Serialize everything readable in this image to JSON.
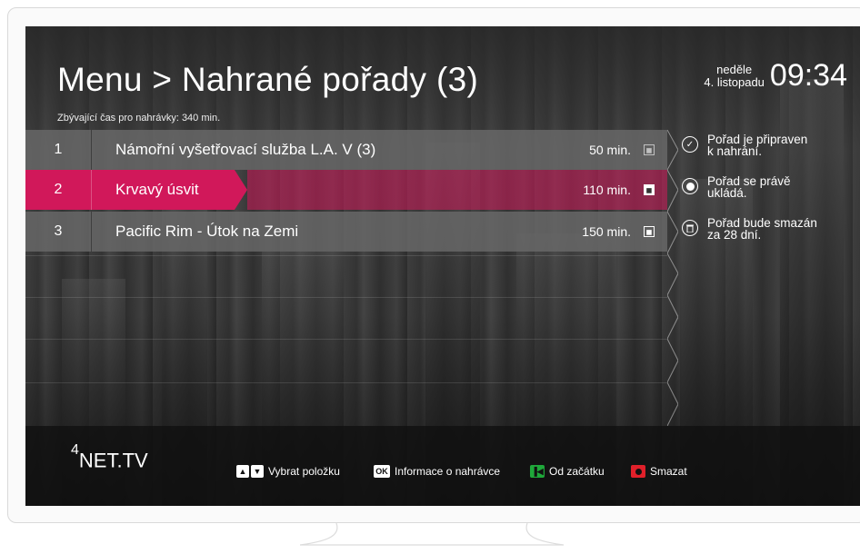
{
  "header": {
    "title": "Menu > Nahrané pořady (3)",
    "remaining": "Zbývající čas pro nahrávky: 340 min.",
    "day": "neděle",
    "date": "4. listopadu",
    "time": "09:34"
  },
  "recordings": [
    {
      "num": "1",
      "name": "Námořní vyšetřovací služba L.A. V (3)",
      "duration": "50 min."
    },
    {
      "num": "2",
      "name": "Krvavý úsvit",
      "duration": "110 min."
    },
    {
      "num": "3",
      "name": "Pacific Rim - Útok na Zemi",
      "duration": "150 min."
    }
  ],
  "legend": [
    {
      "icon": "check-circle-icon",
      "text1": "Pořad je připraven",
      "text2": "k nahrání."
    },
    {
      "icon": "record-dot-icon",
      "text1": "Pořad se právě",
      "text2": "ukládá."
    },
    {
      "icon": "trash-circle-icon",
      "text1": "Pořad bude smazán",
      "text2": "za 28 dní."
    }
  ],
  "footer": {
    "logo_sup": "4",
    "logo": "NET.TV",
    "hint_select": "Vybrat položku",
    "ok_key": "OK",
    "hint_info": "Informace o nahrávce",
    "hint_start": "Od začátku",
    "hint_delete": "Smazat"
  },
  "colors": {
    "accent": "#d1185a",
    "row": "#6a6a6a",
    "green_key": "#1fa83a",
    "red_key": "#e0202a"
  }
}
